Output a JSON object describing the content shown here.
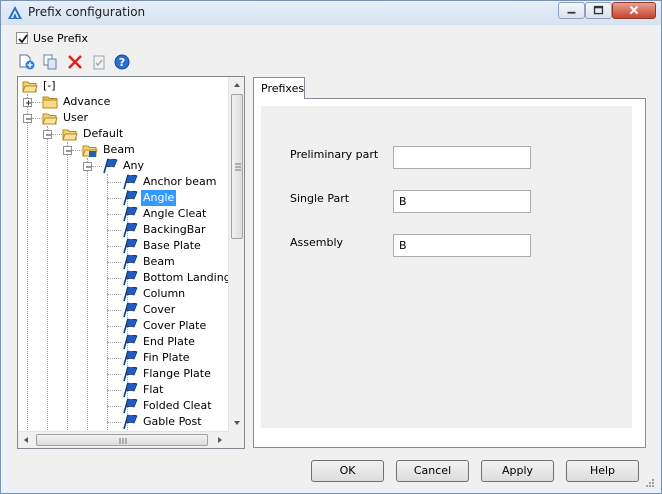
{
  "window": {
    "title": "Prefix configuration"
  },
  "use_prefix": {
    "label": "Use Prefix",
    "checked": true
  },
  "toolbar": {
    "icons": [
      "add-icon",
      "copy-icon",
      "delete-icon",
      "clipboard-icon",
      "help-icon"
    ]
  },
  "tree": {
    "items": [
      {
        "label": "[-]",
        "icon": "folder-open-icon"
      },
      {
        "label": "Advance",
        "icon": "folder-icon",
        "expander": "+"
      },
      {
        "label": "User",
        "icon": "folder-open-icon",
        "expander": "-"
      },
      {
        "label": "Default",
        "icon": "folder-open-icon",
        "expander": "-"
      },
      {
        "label": "Beam",
        "icon": "folder-open-icon",
        "expander": "-"
      },
      {
        "label": "Any",
        "icon": "flag-icon",
        "expander": "-"
      },
      {
        "label": "Anchor beam",
        "icon": "flag-icon"
      },
      {
        "label": "Angle",
        "icon": "flag-icon",
        "selected": true
      },
      {
        "label": "Angle Cleat",
        "icon": "flag-icon"
      },
      {
        "label": "BackingBar",
        "icon": "flag-icon"
      },
      {
        "label": "Base Plate",
        "icon": "flag-icon"
      },
      {
        "label": "Beam",
        "icon": "flag-icon"
      },
      {
        "label": "Bottom Landing",
        "icon": "flag-icon"
      },
      {
        "label": "Column",
        "icon": "flag-icon"
      },
      {
        "label": "Cover",
        "icon": "flag-icon"
      },
      {
        "label": "Cover Plate",
        "icon": "flag-icon"
      },
      {
        "label": "End Plate",
        "icon": "flag-icon"
      },
      {
        "label": "Fin Plate",
        "icon": "flag-icon"
      },
      {
        "label": "Flange Plate",
        "icon": "flag-icon"
      },
      {
        "label": "Flat",
        "icon": "flag-icon"
      },
      {
        "label": "Folded Cleat",
        "icon": "flag-icon"
      },
      {
        "label": "Gable Post",
        "icon": "flag-icon"
      }
    ]
  },
  "tabs": [
    {
      "label": "Prefixes",
      "active": true
    }
  ],
  "prefixes": {
    "preliminary_part": {
      "label": "Preliminary part",
      "value": ""
    },
    "single_part": {
      "label": "Single Part",
      "value": "B"
    },
    "assembly": {
      "label": "Assembly",
      "value": "B"
    }
  },
  "buttons": {
    "ok": "OK",
    "cancel": "Cancel",
    "apply": "Apply",
    "help": "Help"
  },
  "colors": {
    "selection": "#3399ff",
    "folder": "#f2c14e",
    "flag": "#1e5fbf",
    "close_button": "#c9432c"
  }
}
